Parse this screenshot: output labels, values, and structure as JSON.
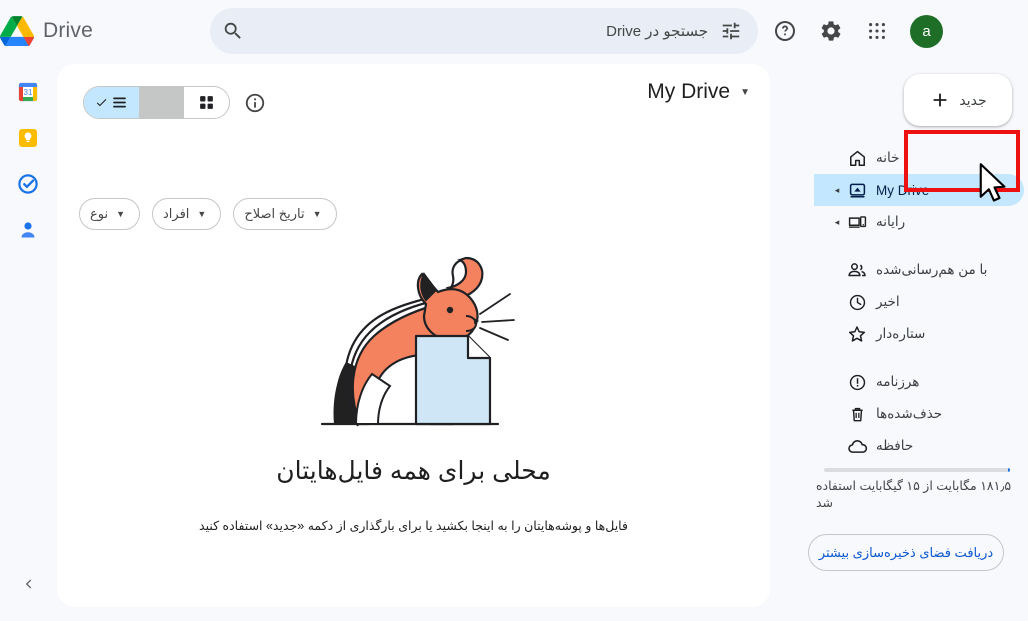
{
  "app": {
    "brand_name": "Drive",
    "logo_icon": "google-drive-logo"
  },
  "topbar": {
    "avatar_letter": "a",
    "avatar_color": "#1e6e28",
    "apps_icon": "apps-grid-icon",
    "settings_icon": "gear-icon",
    "help_icon": "help-circle-icon",
    "search": {
      "placeholder": "جستجو در Drive",
      "value": "",
      "search_icon": "search-icon",
      "tune_icon": "tune-sliders-icon"
    }
  },
  "leftrail": {
    "items": [
      {
        "name": "calendar",
        "icon": "google-calendar-icon",
        "label": "31"
      },
      {
        "name": "keep",
        "icon": "google-keep-icon",
        "label": ""
      },
      {
        "name": "tasks",
        "icon": "google-tasks-icon",
        "label": ""
      },
      {
        "name": "contacts",
        "icon": "google-contacts-icon",
        "label": ""
      }
    ],
    "collapse_icon": "chevron-left-icon"
  },
  "sidebar": {
    "new_button": {
      "label": "جدید",
      "icon": "plus-icon"
    },
    "items": [
      {
        "label": "خانه",
        "icon": "home-icon",
        "expandable": false,
        "active": false
      },
      {
        "label": "My Drive",
        "icon": "my-drive-icon",
        "expandable": true,
        "active": true
      },
      {
        "label": "رایانه",
        "icon": "computer-icon",
        "expandable": true,
        "active": false
      },
      {
        "label": "با من هم‌رسانی‌شده",
        "icon": "people-icon",
        "expandable": false,
        "active": false
      },
      {
        "label": "اخیر",
        "icon": "clock-icon",
        "expandable": false,
        "active": false
      },
      {
        "label": "ستاره‌دار",
        "icon": "star-icon",
        "expandable": false,
        "active": false
      },
      {
        "label": "هرزنامه",
        "icon": "spam-exclamation-icon",
        "expandable": false,
        "active": false
      },
      {
        "label": "حذف‌شده‌ها",
        "icon": "trash-icon",
        "expandable": false,
        "active": false
      },
      {
        "label": "حافظه",
        "icon": "cloud-icon",
        "expandable": false,
        "active": false
      }
    ],
    "storage": {
      "used_percent": 1.2,
      "text": "۱۸۱٫۵ مگابایت از ۱۵ گیگابایت استفاده شد",
      "bar_color": "#1a73e8",
      "more_storage_label": "دریافت فضای ذخیره‌سازی بیشتر"
    }
  },
  "main": {
    "page_title": "My Drive",
    "title_caret_icon": "caret-down-icon",
    "info_icon": "info-circle-icon",
    "view_grid_icon": "grid-view-icon",
    "view_list_icon": "list-view-icon",
    "view_check_icon": "check-icon",
    "active_view": "list",
    "filters": [
      {
        "label": "نوع",
        "caret_icon": "caret-down-icon"
      },
      {
        "label": "افراد",
        "caret_icon": "caret-down-icon"
      },
      {
        "label": "تاریخ اصلاح",
        "caret_icon": "caret-down-icon"
      }
    ],
    "empty_state": {
      "illustration": "cat-with-document-illustration",
      "title": "محلی برای همه فایل‌هایتان",
      "subtitle": "فایل‌ها و پوشه‌هایتان را به اینجا بکشید یا برای بارگذاری از دکمه «جدید» استفاده کنید"
    }
  },
  "annotation": {
    "highlight_color": "#ee1111",
    "target": "جدید",
    "cursor_icon": "mouse-cursor-arrow"
  },
  "colors": {
    "page_bg": "#f8f9fd",
    "card_bg": "#ffffff",
    "accent_blue": "#c2e7ff",
    "link_blue": "#0b57d0"
  }
}
